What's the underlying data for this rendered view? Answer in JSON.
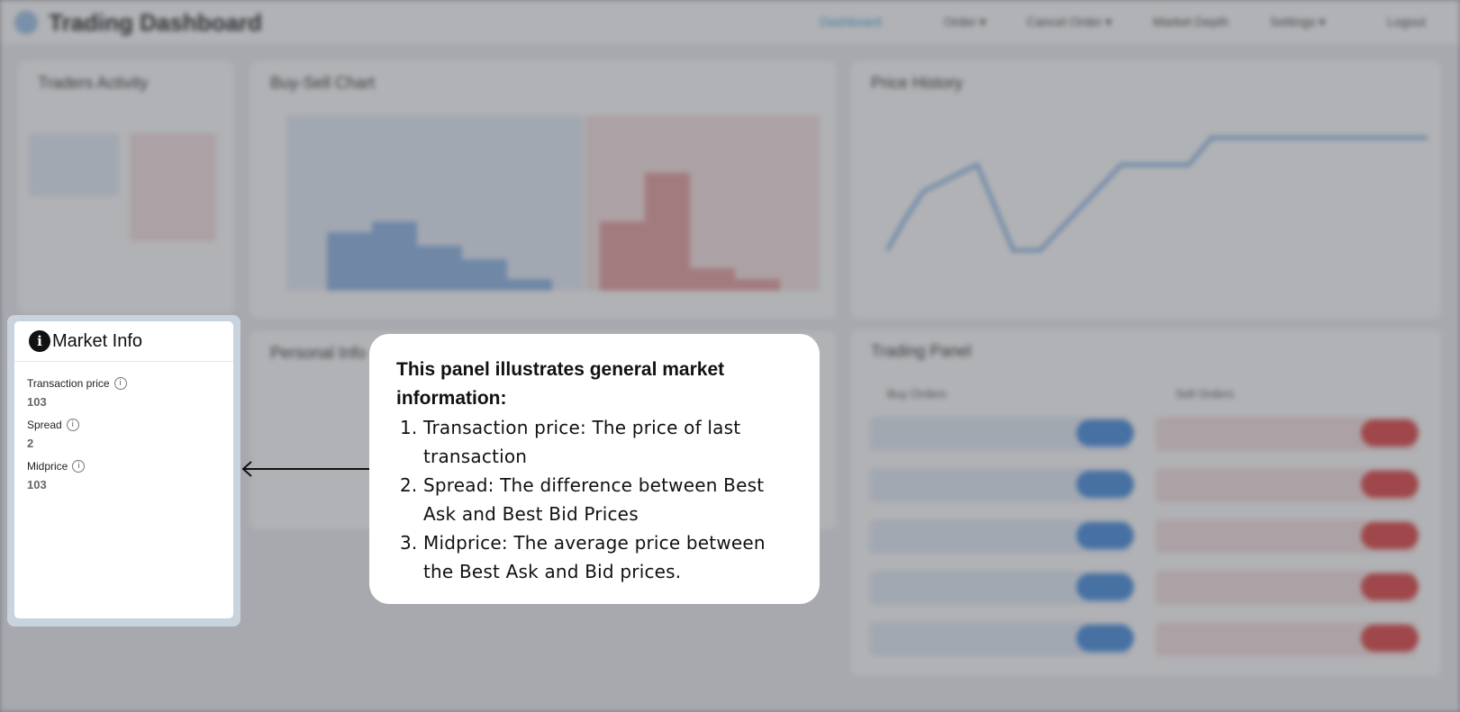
{
  "background": {
    "app_title": "Trading Dashboard",
    "nav": [
      "Dashboard",
      "Order ▾",
      "Cancel Order ▾",
      "Market Depth",
      "Settings ▾",
      "Logout"
    ],
    "panels": [
      "Traders Activity",
      "Buy-Sell Chart",
      "Price History",
      "Personal Info",
      "Trading Panel"
    ],
    "trading_panel": {
      "buy_label": "Buy Orders",
      "sell_label": "Sell Orders"
    }
  },
  "market_info": {
    "title": "Market Info",
    "metrics": [
      {
        "label": "Transaction price",
        "value": "103"
      },
      {
        "label": "Spread",
        "value": "2"
      },
      {
        "label": "Midprice",
        "value": "103"
      }
    ]
  },
  "tooltip": {
    "heading": "This panel illustrates general market information:",
    "items": [
      "Transaction price: The price of last transaction",
      "Spread: The difference between Best Ask and Best Bid Prices",
      "Midprice:  The average price between the Best Ask and Bid prices."
    ]
  },
  "icons": {
    "card_icon": "info-icon",
    "metric_help": "info-outline-icon",
    "pointer": "arrow-left-icon"
  },
  "colors": {
    "buy": "#4a8fe0",
    "sell": "#e04848",
    "overlay": "#9c9fa3",
    "spotlight": "#c9d3de"
  }
}
